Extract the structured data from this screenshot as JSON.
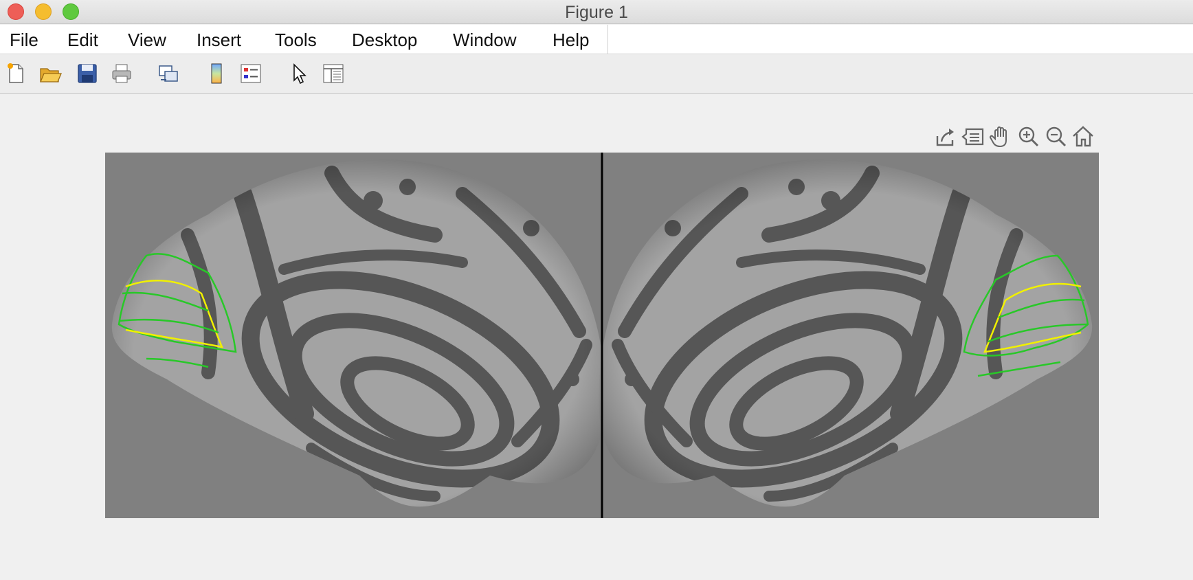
{
  "window": {
    "title": "Figure 1"
  },
  "menubar": {
    "items": [
      "File",
      "Edit",
      "View",
      "Insert",
      "Tools",
      "Desktop",
      "Window",
      "Help"
    ]
  },
  "toolbar": {
    "buttons": [
      {
        "name": "new-figure",
        "icon": "new-file-icon"
      },
      {
        "name": "open-file",
        "icon": "folder-open-icon"
      },
      {
        "name": "save-figure",
        "icon": "save-icon"
      },
      {
        "name": "print-figure",
        "icon": "printer-icon"
      },
      {
        "name": "link-plot",
        "icon": "link-plot-icon"
      },
      {
        "name": "insert-colorbar",
        "icon": "colorbar-icon"
      },
      {
        "name": "insert-legend",
        "icon": "legend-icon"
      },
      {
        "name": "edit-plot",
        "icon": "pointer-icon"
      },
      {
        "name": "property-inspector",
        "icon": "panel-icon"
      }
    ]
  },
  "axes_toolbar": {
    "buttons": [
      {
        "name": "export",
        "icon": "export-icon"
      },
      {
        "name": "brush-data",
        "icon": "data-tips-icon"
      },
      {
        "name": "pan",
        "icon": "hand-pan-icon"
      },
      {
        "name": "zoom-in",
        "icon": "zoom-in-icon"
      },
      {
        "name": "zoom-out",
        "icon": "zoom-out-icon"
      },
      {
        "name": "restore-view",
        "icon": "home-icon"
      }
    ]
  },
  "figure": {
    "content": "medial inflated brain hemispheres with sulcal map and label outlines",
    "colors": {
      "background": "#808080",
      "gyri": "#a3a3a3",
      "sulci": "#565656",
      "divider": "#000000",
      "outline_green": "#28c828",
      "outline_yellow": "#f0f000"
    }
  }
}
